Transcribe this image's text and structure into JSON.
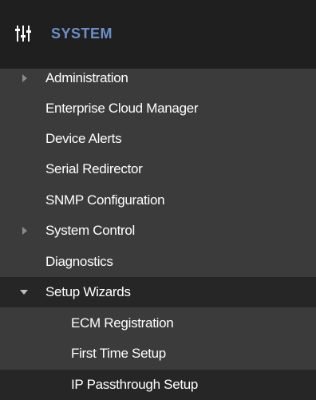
{
  "header": {
    "title": "SYSTEM",
    "icon": "sliders-icon",
    "title_color": "#6d8fc9"
  },
  "menu": [
    {
      "label": "Administration",
      "expander": "collapsed"
    },
    {
      "label": "Enterprise Cloud Manager"
    },
    {
      "label": "Device Alerts"
    },
    {
      "label": "Serial Redirector"
    },
    {
      "label": "SNMP Configuration"
    },
    {
      "label": "System Control",
      "expander": "collapsed"
    },
    {
      "label": "Diagnostics"
    },
    {
      "label": "Setup Wizards",
      "expander": "expanded",
      "highlighted": true,
      "children": [
        {
          "label": "ECM Registration"
        },
        {
          "label": "First Time Setup"
        },
        {
          "label": "IP Passthrough Setup",
          "highlighted": true
        }
      ]
    }
  ],
  "colors": {
    "panel_bg": "#3b3b3b",
    "header_bg": "#1f1f1f",
    "highlight_bg": "#262626",
    "text": "#ffffff"
  }
}
